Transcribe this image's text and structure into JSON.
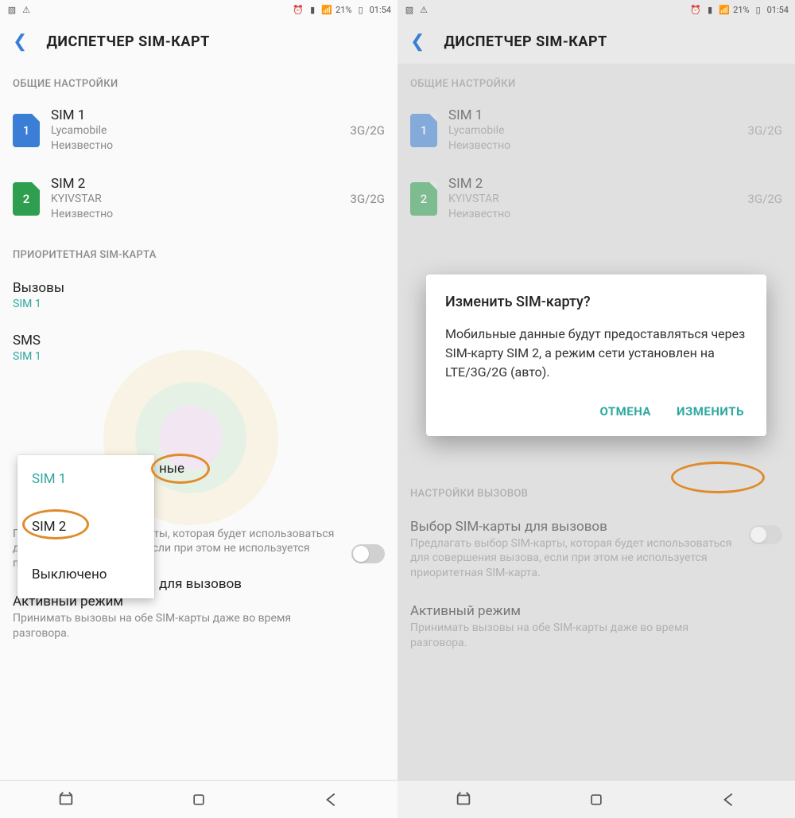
{
  "status": {
    "battery_pct": "21%",
    "time": "01:54"
  },
  "header": {
    "title": "ДИСПЕТЧЕР SIM-КАРТ"
  },
  "sections": {
    "general": "ОБЩИЕ НАСТРОЙКИ",
    "priority": "ПРИОРИТЕТНАЯ SIM-КАРТА",
    "call_settings": "НАСТРОЙКИ ВЫЗОВОВ"
  },
  "sims": [
    {
      "num": "1",
      "title": "SIM 1",
      "carrier": "Lycamobile",
      "status": "Неизвестно",
      "net": "3G/2G"
    },
    {
      "num": "2",
      "title": "SIM 2",
      "carrier": "KYIVSTAR",
      "status": "Неизвестно",
      "net": "3G/2G"
    }
  ],
  "prefs": {
    "calls_label": "Вызовы",
    "calls_val": "SIM 1",
    "sms_label": "SMS",
    "sms_val": "SIM 1"
  },
  "popup": {
    "opt1": "SIM 1",
    "opt2": "SIM 2",
    "opt3": "Выключено"
  },
  "frag": {
    "nye": "ные",
    "three": "3",
    "calls": " для вызовов"
  },
  "settings": {
    "sim_select_title": "Выбор SIM-карты для вызовов",
    "sim_select_sub": "Предлагать выбор SIM-карты, которая будет использоваться для совершения вызова, если при этом не используется приоритетная SIM-карта.",
    "active_title": "Активный режим",
    "active_sub": "Принимать вызовы на обе SIM-карты даже во время разговора."
  },
  "dialog": {
    "title": "Изменить SIM-карту?",
    "body": "Мобильные данные будут предоставляться через SIM-карту SIM 2, а режим сети установлен на LTE/3G/2G (авто).",
    "cancel": "ОТМЕНА",
    "confirm": "ИЗМЕНИТЬ"
  }
}
